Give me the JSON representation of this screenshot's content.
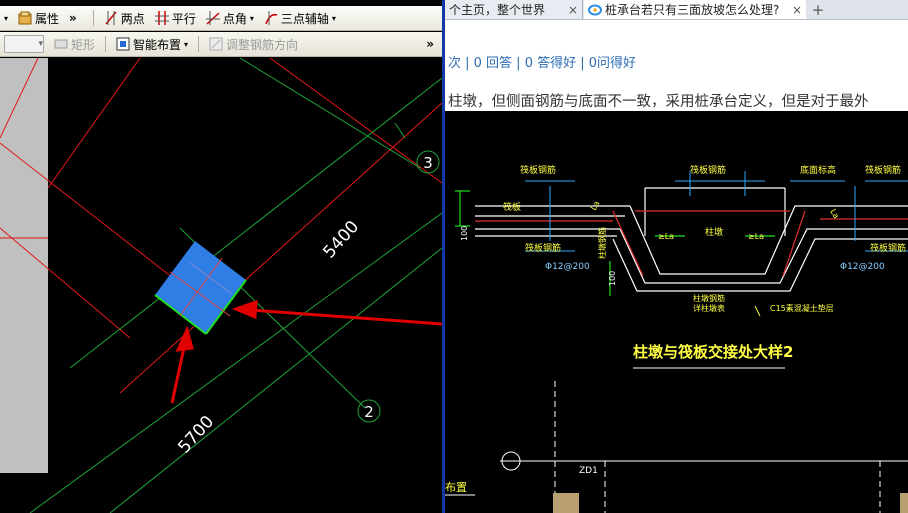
{
  "cad": {
    "toolbar1": {
      "properties_label": "属性",
      "two_points_label": "两点",
      "parallel_label": "平行",
      "point_angle_label": "点角",
      "three_point_axis_label": "三点辅轴",
      "overflow": "»"
    },
    "toolbar2": {
      "rectangle_label": "矩形",
      "smart_layout_label": "智能布置",
      "adjust_rebar_label": "调整钢筋方向",
      "overflow": "»"
    },
    "canvas": {
      "dimension_top": "5400",
      "dimension_bottom": "5700",
      "axis_label_3": "3",
      "axis_label_2": "2"
    }
  },
  "browser": {
    "tabs": [
      {
        "title": "个主页，整个世界",
        "close": "×"
      },
      {
        "title": "桩承台若只有三面放坡怎么处理?",
        "close": "×"
      }
    ],
    "new_tab": "+",
    "stats": "次 | 0 回答 | 0 答得好 | 0问得好",
    "question": "柱墩，但侧面钢筋与底面不一致，采用桩承台定义，但是对于最外",
    "drawing": {
      "raft_rebar_1": "筏板钢筋",
      "raft_rebar_2": "筏板钢筋",
      "raft_top": "底面标高",
      "raft_rebar_3": "筏板钢筋",
      "raft": "筏板",
      "column_pier": "柱墩",
      "lae_1": "≥La",
      "lae_2": "≥La",
      "la_left": "La",
      "la_right": "La",
      "dim_100_left": "100",
      "dim_100_mid": "100",
      "raft_rebar_bottom_left": "筏板钢筋",
      "raft_rebar_bottom_right": "筏板钢筋",
      "rebar_left": "Φ12@200",
      "rebar_right": "Φ12@200",
      "column_rebar": "柱墩钢筋",
      "column_rebar_2": "详柱墩表",
      "cushion": "C15素混凝土垫层",
      "title": "柱墩与筏板交接处大样2",
      "zd1": "ZD1",
      "layout": "布置",
      "col_vertical": "柱墩钢筋"
    }
  }
}
